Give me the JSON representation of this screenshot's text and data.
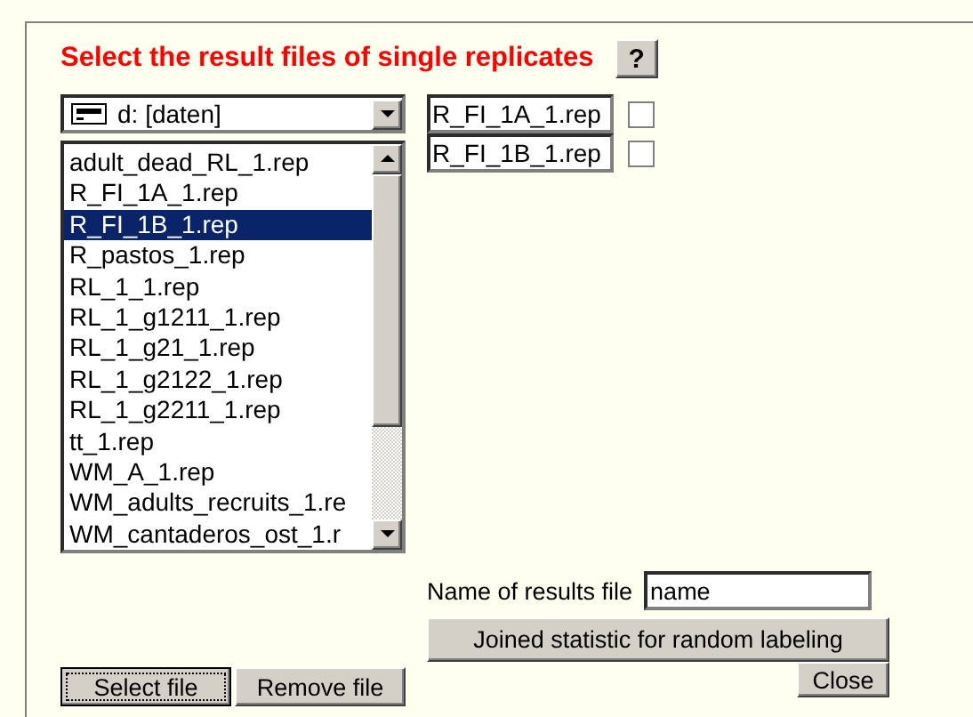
{
  "title": "Select the result files of single replicates",
  "help_button": "?",
  "drive": {
    "label": "d: [daten]"
  },
  "files": [
    {
      "name": "adult_dead_RL_1.rep",
      "selected": false
    },
    {
      "name": "R_FI_1A_1.rep",
      "selected": false
    },
    {
      "name": "R_FI_1B_1.rep",
      "selected": true
    },
    {
      "name": "R_pastos_1.rep",
      "selected": false
    },
    {
      "name": "RL_1_1.rep",
      "selected": false
    },
    {
      "name": "RL_1_g1211_1.rep",
      "selected": false
    },
    {
      "name": "RL_1_g21_1.rep",
      "selected": false
    },
    {
      "name": "RL_1_g2122_1.rep",
      "selected": false
    },
    {
      "name": "RL_1_g2211_1.rep",
      "selected": false
    },
    {
      "name": "tt_1.rep",
      "selected": false
    },
    {
      "name": "WM_A_1.rep",
      "selected": false
    },
    {
      "name": "WM_adults_recruits_1.re",
      "selected": false
    },
    {
      "name": "WM_cantaderos_ost_1.r",
      "selected": false
    }
  ],
  "chosen": [
    {
      "name": "R_FI_1A_1.rep",
      "checked": false
    },
    {
      "name": "R_FI_1B_1.rep",
      "checked": false
    }
  ],
  "results_name": {
    "label": "Name of results file",
    "value": "name"
  },
  "buttons": {
    "select": "Select file",
    "remove": "Remove file",
    "joined": "Joined statistic for random labeling",
    "close": "Close"
  }
}
